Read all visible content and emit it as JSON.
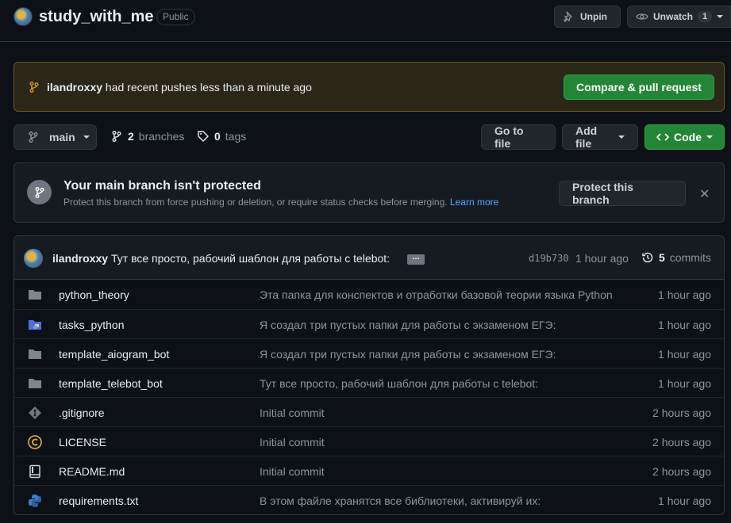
{
  "repo": {
    "name": "study_with_me",
    "visibility": "Public",
    "unpin_label": "Unpin",
    "unwatch_label": "Unwatch",
    "watch_count": "1"
  },
  "push_banner": {
    "user": "ilandroxxy",
    "text": "had recent pushes less than a minute ago",
    "button": "Compare & pull request",
    "background_color": "#2b2718"
  },
  "toolbar": {
    "branch": "main",
    "branches_count": "2",
    "branches_label": "branches",
    "tags_count": "0",
    "tags_label": "tags",
    "go_to_file": "Go to file",
    "add_file": "Add file",
    "code": "Code",
    "code_color": "#238636"
  },
  "protect": {
    "title": "Your main branch isn't protected",
    "description": "Protect this branch from force pushing or deletion, or require status checks before merging.",
    "learn_more": "Learn more",
    "button": "Protect this branch"
  },
  "latest_commit": {
    "author": "ilandroxxy",
    "message": "Тут все просто, рабочий шаблон для работы с telebot:",
    "ellipsis": "…",
    "sha": "d19b730",
    "time": "1 hour ago",
    "count": "5",
    "count_label": "commits"
  },
  "files": [
    {
      "name": "python_theory",
      "icon": "folder-icon",
      "message": "Эта папка для конспектов и отработки базовой теории языка Python",
      "age": "1 hour ago"
    },
    {
      "name": "tasks_python",
      "icon": "folder-python-icon",
      "message": "Я создал три пустых папки для работы с экзаменом ЕГЭ:",
      "age": "1 hour ago"
    },
    {
      "name": "template_aiogram_bot",
      "icon": "folder-icon",
      "message": "Я создал три пустых папки для работы с экзаменом ЕГЭ:",
      "age": "1 hour ago"
    },
    {
      "name": "template_telebot_bot",
      "icon": "folder-icon",
      "message": "Тут все просто, рабочий шаблон для работы с telebot:",
      "age": "1 hour ago"
    },
    {
      "name": ".gitignore",
      "icon": "git-icon",
      "message": "Initial commit",
      "age": "2 hours ago"
    },
    {
      "name": "LICENSE",
      "icon": "license-icon",
      "message": "Initial commit",
      "age": "2 hours ago"
    },
    {
      "name": "README.md",
      "icon": "book-icon",
      "message": "Initial commit",
      "age": "2 hours ago"
    },
    {
      "name": "requirements.txt",
      "icon": "python-icon",
      "message": "В этом файле хранятся все библиотеки, активируй их:",
      "age": "1 hour ago"
    }
  ]
}
